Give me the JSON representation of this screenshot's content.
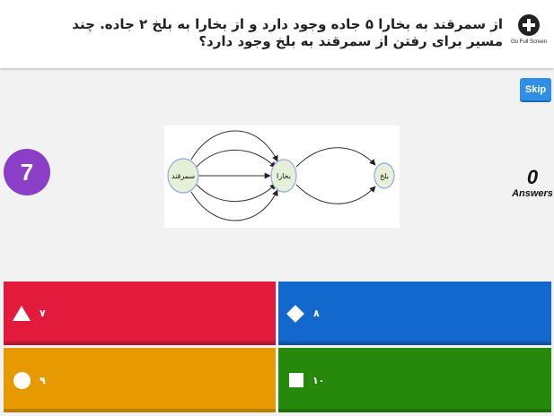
{
  "question": {
    "text": "از سمرقند به بخارا ۵ جاده وجود دارد و از بخارا به بلخ ۲ جاده. چند مسیر برای رفتن از سمرقند به بلخ وجود دارد؟"
  },
  "fullscreen": {
    "label": "Go Full Screen",
    "icon": "plus-circle-icon"
  },
  "skip": {
    "label": "Skip"
  },
  "timer": {
    "value": "7"
  },
  "answers_counter": {
    "count": "0",
    "label": "Answers"
  },
  "diagram": {
    "nodes": [
      {
        "id": "samarkand",
        "label": "سمرقند"
      },
      {
        "id": "bukhara",
        "label": "بخارا"
      },
      {
        "id": "balkh",
        "label": "بلخ"
      }
    ],
    "edges": {
      "samarkand_to_bukhara": 5,
      "bukhara_to_balkh": 2
    }
  },
  "choices": [
    {
      "shape": "triangle",
      "text": "۷",
      "color": "#e21b3c"
    },
    {
      "shape": "diamond",
      "text": "۸",
      "color": "#1368ce"
    },
    {
      "shape": "circle",
      "text": "۹",
      "color": "#e69a00"
    },
    {
      "shape": "square",
      "text": "۱۰",
      "color": "#26890c"
    }
  ]
}
